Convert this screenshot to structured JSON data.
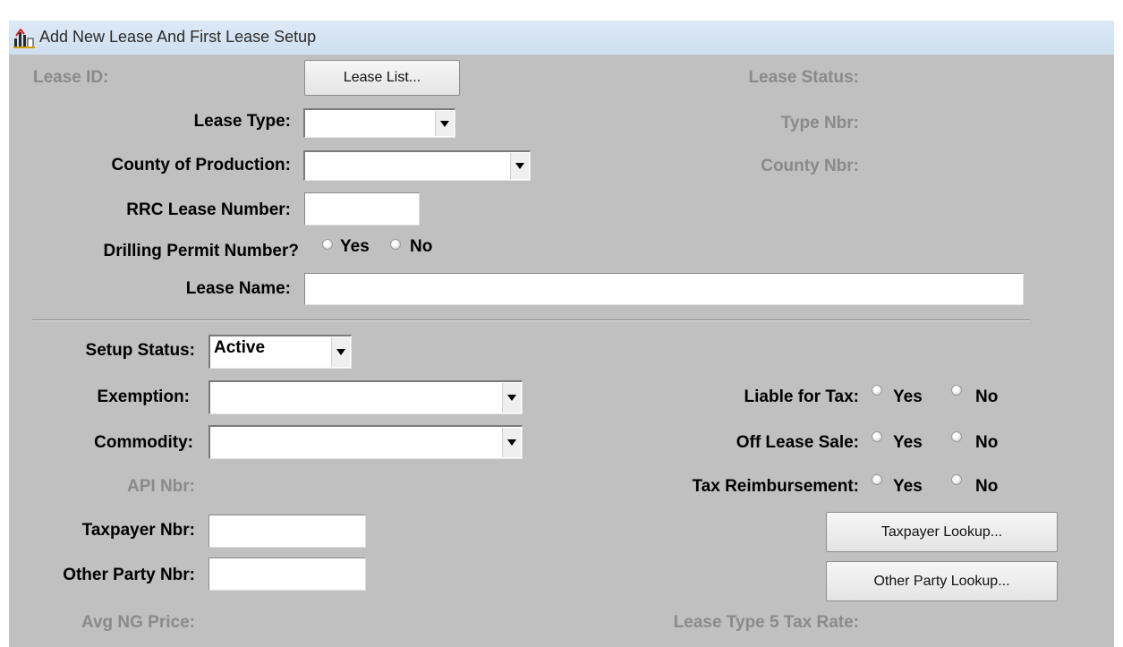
{
  "window": {
    "title": "Add New Lease And First Lease Setup",
    "icon": "app-icon"
  },
  "lease": {
    "id_label": "Lease ID:",
    "list_button": "Lease List...",
    "status_label": "Lease Status:",
    "type_label": "Lease Type:",
    "type_value": "",
    "type_nbr_label": "Type  Nbr:",
    "county_label": "County of Production:",
    "county_value": "",
    "county_nbr_label": "County Nbr:",
    "rrc_label": "RRC Lease Number:",
    "rrc_value": "",
    "drilling_label": "Drilling Permit Number?",
    "yes": "Yes",
    "no": "No",
    "name_label": "Lease Name:",
    "name_value": ""
  },
  "setup": {
    "status_label": "Setup Status:",
    "status_value": "Active",
    "exemption_label": "Exemption:",
    "exemption_value": "",
    "commodity_label": "Commodity:",
    "commodity_value": "",
    "api_label": "API Nbr:",
    "taxpayer_label": "Taxpayer Nbr:",
    "taxpayer_value": "",
    "other_party_label": "Other Party Nbr:",
    "other_party_value": "",
    "avg_ng_label": "Avg NG Price:",
    "liable_label": "Liable for Tax:",
    "off_lease_label": "Off Lease Sale:",
    "tax_reimb_label": "Tax Reimbursement:",
    "yes": "Yes",
    "no": "No",
    "taxpayer_lookup_button": "Taxpayer Lookup...",
    "other_party_lookup_button": "Other Party Lookup...",
    "lease_type5_label": "Lease Type 5 Tax Rate:"
  }
}
